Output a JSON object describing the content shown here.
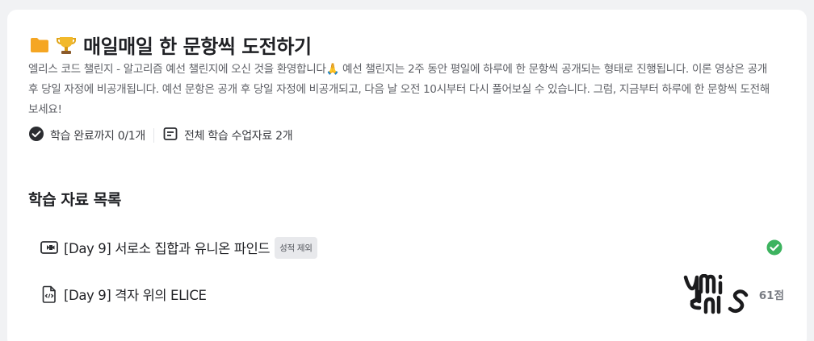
{
  "header": {
    "title": "매일매일 한 문항씩 도전하기",
    "description": "엘리스 코드 챌린지 - 알고리즘 예선 챌린지에 오신 것을 환영합니다🙏 예선 챌린지는 2주 동안 평일에 하루에 한 문항씩 공개되는 형태로 진행됩니다. 이론 영상은 공개 후 당일 자정에 비공개됩니다. 예선 문항은 공개 후 당일 자정에 비공개되고, 다음 날 오전 10시부터 다시 풀어보실 수 있습니다. 그럼, 지금부터 하루에 한 문항씩 도전해보세요!",
    "progress_label": "학습 완료까지 0/1개",
    "materials_label": "전체 학습 수업자료 2개"
  },
  "section": {
    "title": "학습 자료 목록"
  },
  "items": [
    {
      "type": "video",
      "label": "[Day 9] 서로소 집합과 유니온 파인드",
      "badge": "성적 제외",
      "completed": true
    },
    {
      "type": "code",
      "label": "[Day 9] 격자 위의 ELICE",
      "score": "61점",
      "signature_text": "ymids"
    }
  ],
  "colors": {
    "folder": "#f5a623",
    "check": "#3db35f",
    "badge_bg": "#e8e9ec"
  }
}
